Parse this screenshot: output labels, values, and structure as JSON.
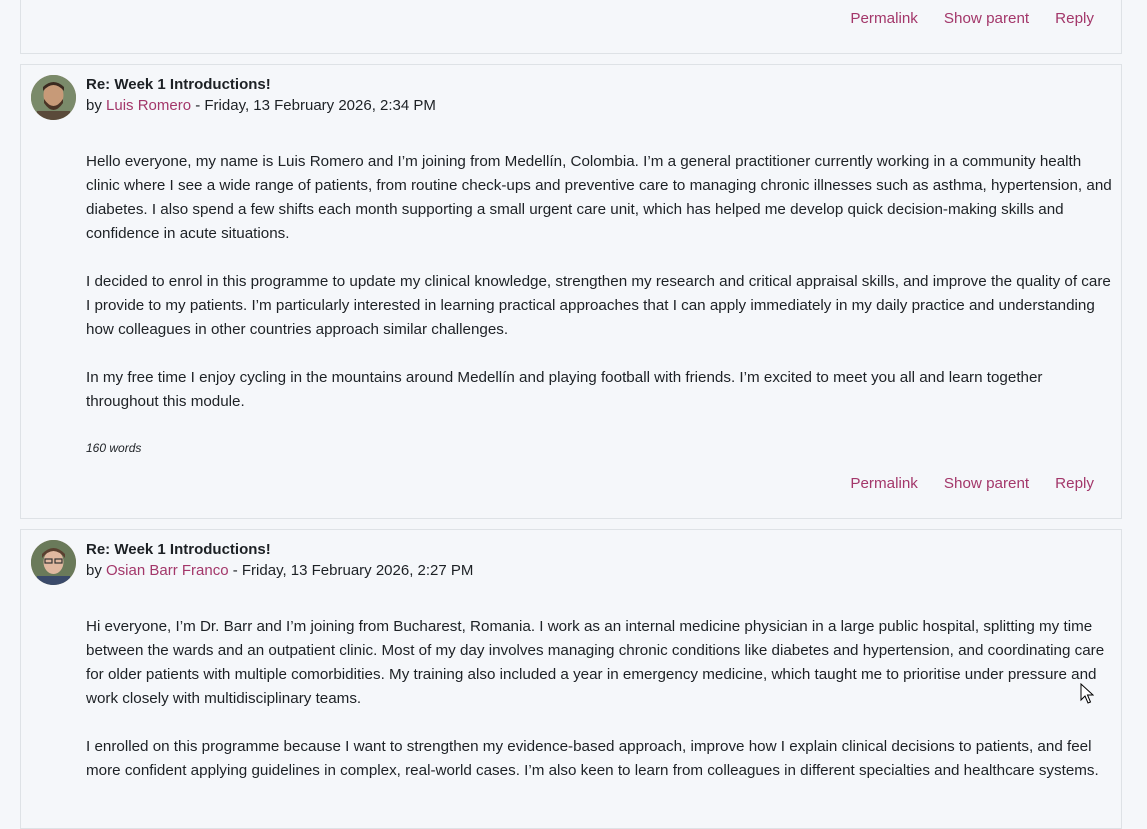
{
  "posts": [
    {
      "actions": {
        "permalink": "Permalink",
        "show_parent": "Show parent",
        "reply": "Reply"
      }
    },
    {
      "title": "Re: Week 1 Introductions!",
      "by": "by",
      "author": "Luis Romero",
      "date": "- Friday, 13 February 2026, 2:34 PM",
      "paragraphs": [
        "Hello everyone, my name is Luis Romero and I’m joining from Medellín, Colombia. I’m a general practitioner currently working in a community health clinic where I see a wide range of patients, from routine check-ups and preventive care to managing chronic illnesses such as asthma, hypertension, and diabetes. I also spend a few shifts each month supporting a small urgent care unit, which has helped me develop quick decision-making skills and confidence in acute situations.",
        "I decided to enrol in this programme to update my clinical knowledge, strengthen my research and critical appraisal skills, and improve the quality of care I provide to my patients. I’m particularly interested in learning practical approaches that I can apply immediately in my daily practice and understanding how colleagues in other countries approach similar challenges.",
        "In my free time I enjoy cycling in the mountains around Medellín and playing football with friends. I’m excited to meet you all and learn together throughout this module."
      ],
      "word_count": "160 words",
      "actions": {
        "permalink": "Permalink",
        "show_parent": "Show parent",
        "reply": "Reply"
      }
    },
    {
      "title": "Re: Week 1 Introductions!",
      "by": "by",
      "author": "Osian Barr Franco",
      "date": "- Friday, 13 February 2026, 2:27 PM",
      "paragraphs": [
        "Hi everyone, I’m Dr. Barr and I’m joining from Bucharest, Romania. I work as an internal medicine physician in a large public hospital, splitting my time between the wards and an outpatient clinic. Most of my day involves managing chronic conditions like diabetes and hypertension, and coordinating care for older patients with multiple comorbidities. My training also included a year in emergency medicine, which taught me to prioritise under pressure and work closely with multidisciplinary teams.",
        "I enrolled on this programme because I want to strengthen my evidence-based approach, improve how I explain clinical decisions to patients, and feel more confident applying guidelines in complex, real-world cases. I’m also keen to learn from colleagues in different specialties and healthcare systems."
      ]
    }
  ]
}
